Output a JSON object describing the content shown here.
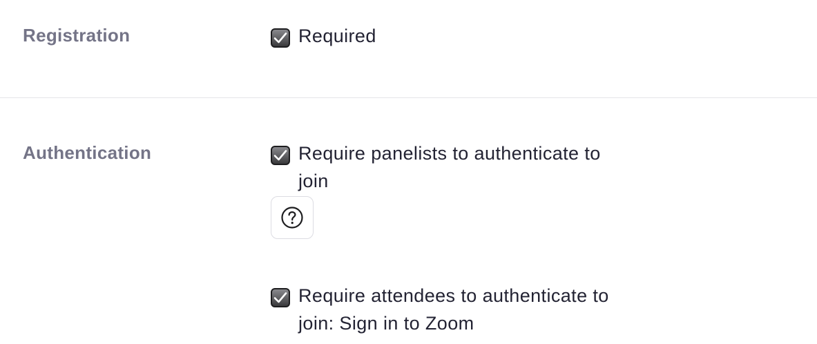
{
  "registration": {
    "label": "Registration",
    "option": {
      "text": "Required",
      "checked": true
    }
  },
  "authentication": {
    "label": "Authentication",
    "panelists_option": {
      "text": "Require panelists to authenticate to join",
      "checked": true
    },
    "help_icon": "question-circle-icon",
    "attendees_option": {
      "text": "Require attendees to authenticate to join: Sign in to Zoom",
      "checked": true
    }
  }
}
